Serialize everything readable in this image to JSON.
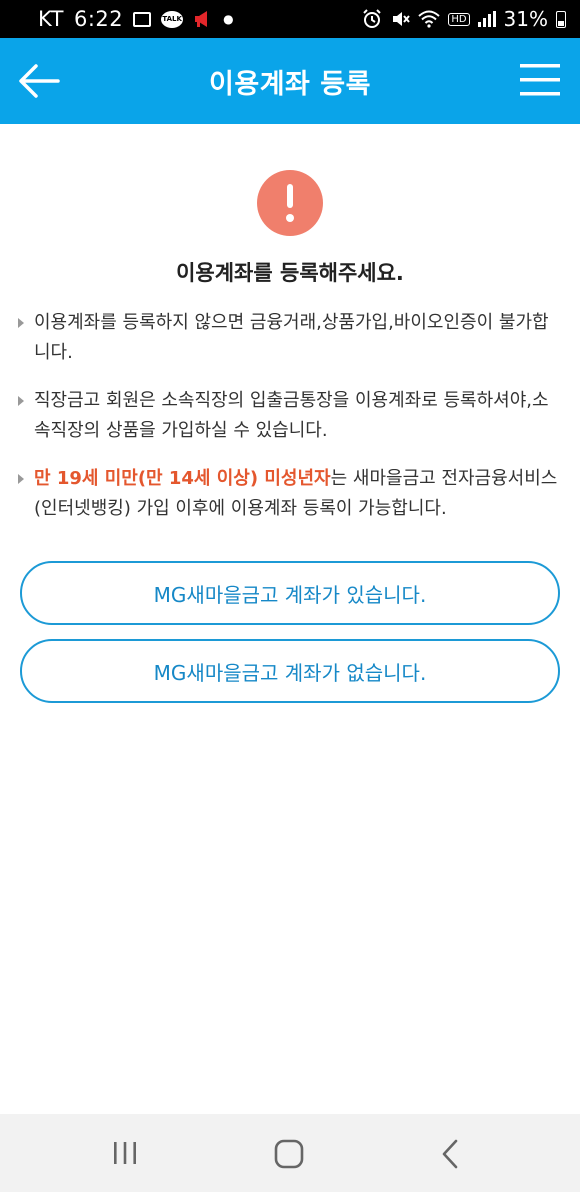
{
  "status_bar": {
    "carrier": "KT",
    "time": "6:22",
    "talk_badge": "TALK",
    "hd_badge": "HD",
    "battery_percent": "31%",
    "icons": [
      "gallery-icon",
      "kakaotalk-icon",
      "megaphone-icon",
      "alarm-icon",
      "mute-icon",
      "wifi-icon",
      "signal-icon",
      "battery-icon"
    ]
  },
  "header": {
    "title": "이용계좌 등록",
    "background_color": "#0aa4e9",
    "back_icon": "arrow-left-icon",
    "menu_icon": "hamburger-menu-icon"
  },
  "alert": {
    "icon": "exclamation-icon",
    "icon_color": "#f07f6c",
    "title": "이용계좌를 등록해주세요."
  },
  "notices": [
    {
      "text": "이용계좌를 등록하지 않으면 금융거래,상품가입,바이오인증이 불가합니다."
    },
    {
      "text": "직장금고 회원은 소속직장의 입출금통장을 이용계좌로 등록하셔야,소속직장의 상품을 가입하실 수 있습니다."
    },
    {
      "highlight": "만 19세 미만(만 14세 이상) 미성년자",
      "text": "는 새마을금고 전자금융서비스(인터넷뱅킹) 가입 이후에 이용계좌 등록이 가능합니다.",
      "highlight_color": "#e4572e"
    }
  ],
  "buttons": {
    "has_account": "MG새마을금고 계좌가 있습니다.",
    "no_account": "MG새마을금고 계좌가 없습니다.",
    "border_color": "#1c9ad6"
  },
  "nav_bar": {
    "icons": [
      "recent-apps-icon",
      "home-icon",
      "back-icon"
    ]
  }
}
